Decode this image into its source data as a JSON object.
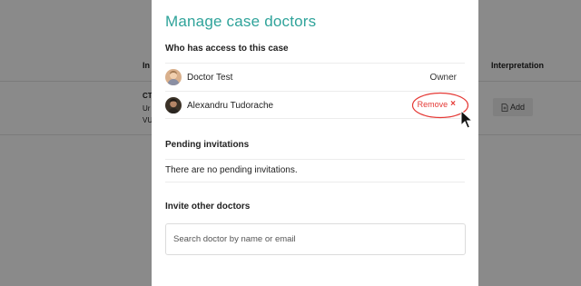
{
  "background": {
    "columns": {
      "ini": "In",
      "interpretation": "Interpretation"
    },
    "row": {
      "line1": "CT",
      "line2": "Ur",
      "line3": "VU"
    },
    "add_button": "Add"
  },
  "modal": {
    "title": "Manage case doctors",
    "access": {
      "heading": "Who has access to this case",
      "doctors": [
        {
          "name": "Doctor Test",
          "role": "Owner"
        },
        {
          "name": "Alexandru Tudorache",
          "action": "Remove"
        }
      ]
    },
    "pending": {
      "heading": "Pending invitations",
      "empty_text": "There are no pending invitations."
    },
    "invite": {
      "heading": "Invite other doctors",
      "search_placeholder": "Search doctor by name or email"
    }
  },
  "colors": {
    "accent": "#2fa39a",
    "danger": "#e53935"
  }
}
